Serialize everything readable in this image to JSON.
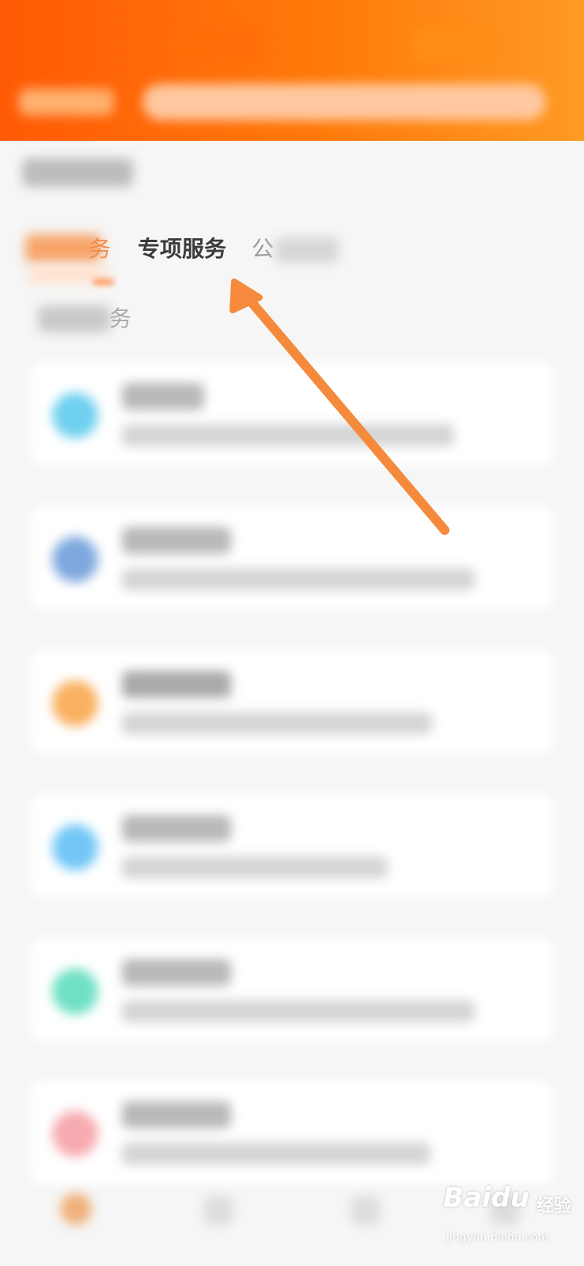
{
  "tabs": {
    "partial_first_suffix": "务",
    "special_services": "专项服务",
    "partial_third_prefix": "公"
  },
  "sub_heading_suffix": "务",
  "colors": {
    "brand_orange": "#ff6b15",
    "arrow_orange": "#f58a3c",
    "icon_colors": [
      "#6fd0f0",
      "#7ea8de",
      "#f9b060",
      "#72c7f7",
      "#6fe0c4",
      "#f7aab0"
    ]
  },
  "watermark": {
    "logo_text": "Baidu",
    "brand_suffix": "经验",
    "url": "jingyan.baidu.com"
  }
}
